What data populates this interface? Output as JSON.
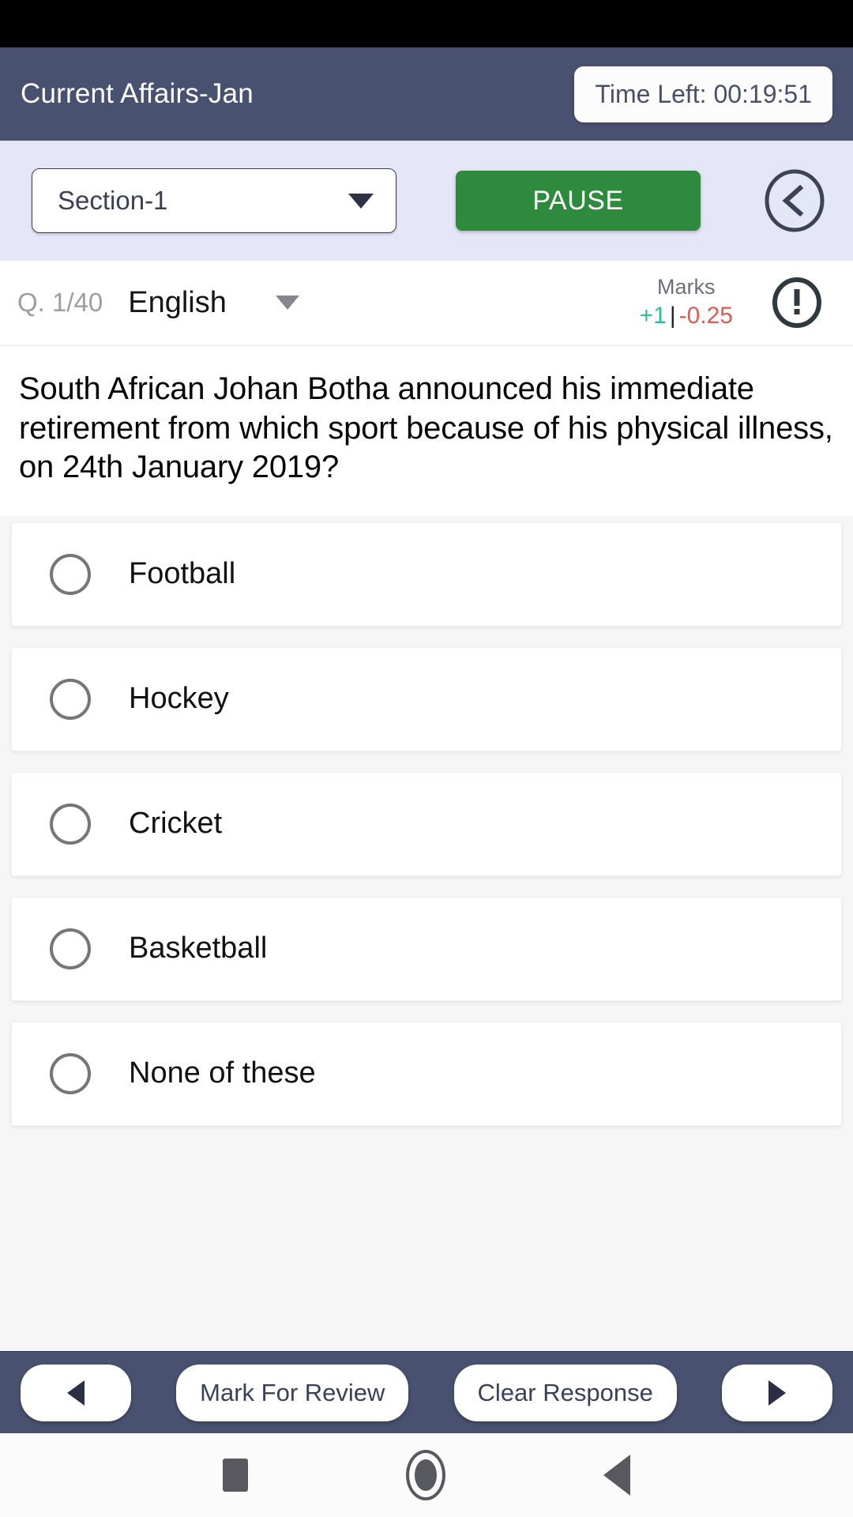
{
  "status_bar": {
    "present": true
  },
  "header": {
    "title": "Current Affairs-Jan",
    "timer_label": "Time Left: 00:19:51",
    "bg_color": "#48516F"
  },
  "section_bar": {
    "section_value": "Section-1",
    "pause_label": "PAUSE",
    "collapse_icon": "chevron-left-circle-icon",
    "bg_color": "#E5E6F8",
    "pause_color": "#2E8B3D"
  },
  "question_meta": {
    "question_index": "Q. 1/40",
    "language": "English",
    "marks_title": "Marks",
    "marks_positive": "+1",
    "marks_separator": "|",
    "marks_negative": "-0.25",
    "positive_color": "#26C09A",
    "negative_color": "#E05A52",
    "report_icon": "exclamation-circle-icon"
  },
  "question": {
    "text": "South African Johan Botha announced his immediate retirement from which sport because of his physical illness, on 24th January 2019?"
  },
  "options": [
    {
      "label": "Football",
      "selected": false
    },
    {
      "label": "Hockey",
      "selected": false
    },
    {
      "label": "Cricket",
      "selected": false
    },
    {
      "label": "Basketball",
      "selected": false
    },
    {
      "label": "None of these",
      "selected": false
    }
  ],
  "action_bar": {
    "prev_icon": "triangle-left-icon",
    "mark_for_review": "Mark For Review",
    "clear_response": "Clear Response",
    "next_icon": "triangle-right-icon"
  },
  "android_nav": {
    "recents_icon": "square-icon",
    "home_icon": "circle-icon",
    "back_icon": "triangle-back-icon"
  }
}
